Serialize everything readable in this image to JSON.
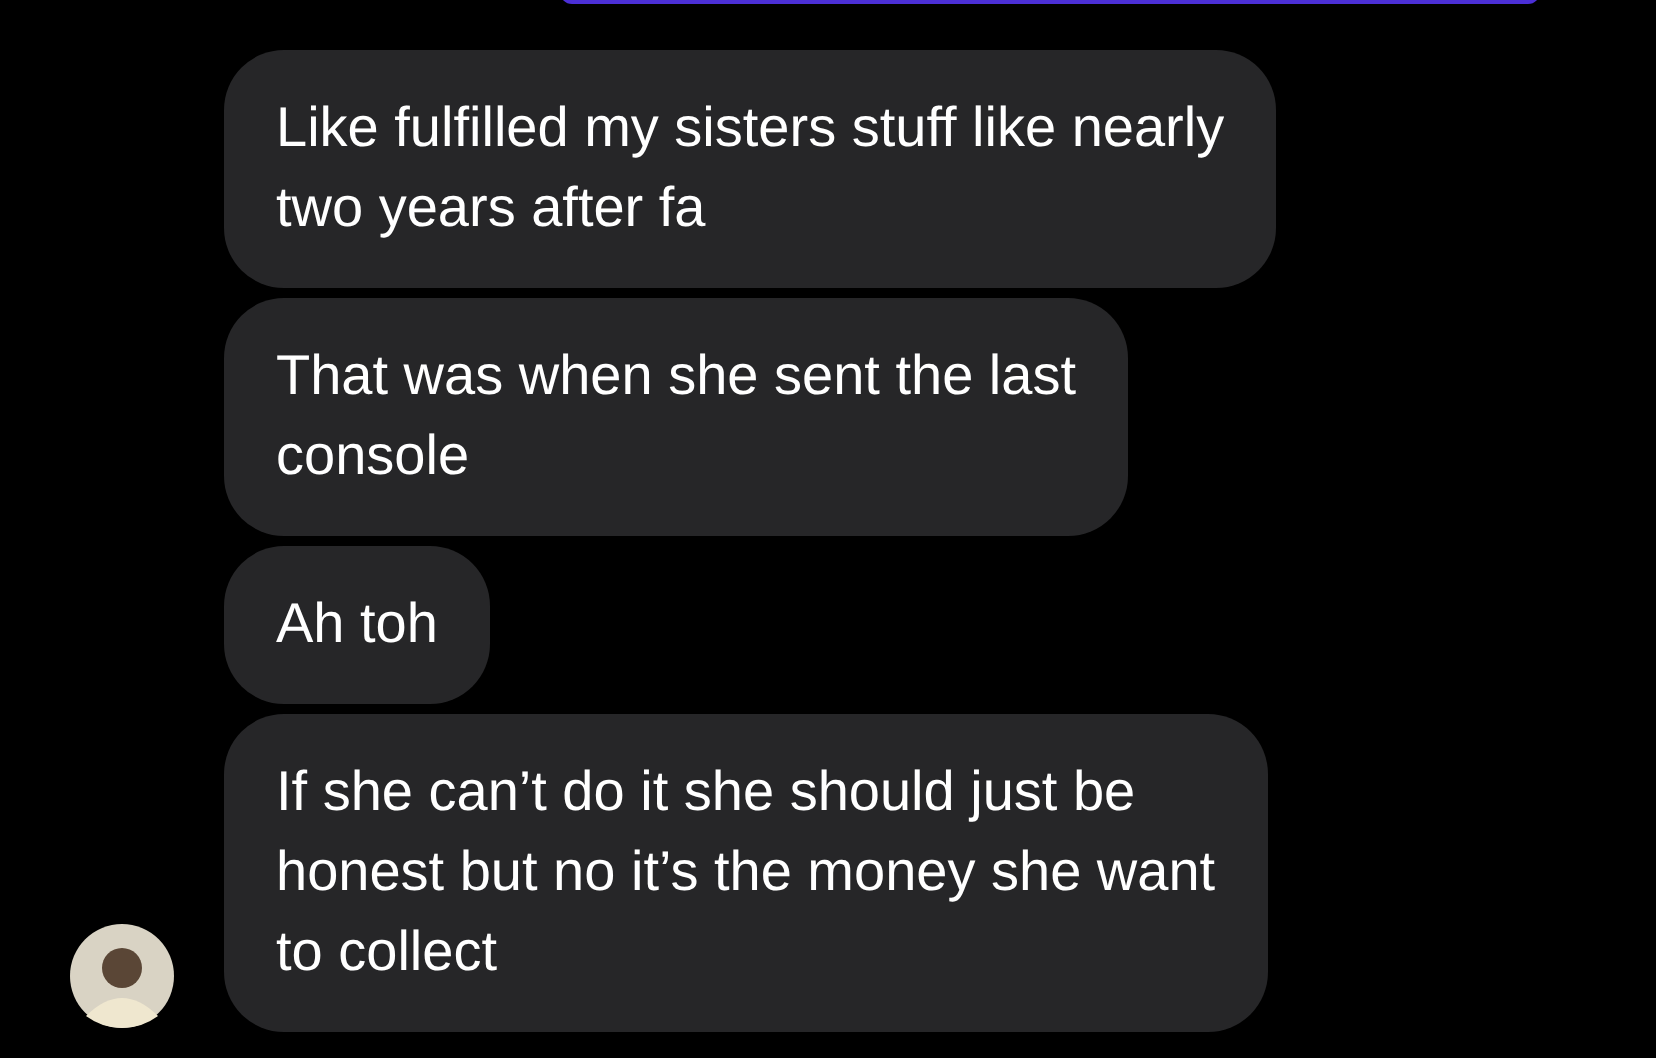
{
  "messages": [
    {
      "text": "Like fulfilled my sisters stuff like nearly\ntwo years after fa",
      "show_avatar": false
    },
    {
      "text": "That was when she sent the last\nconsole",
      "show_avatar": false
    },
    {
      "text": "Ah toh",
      "show_avatar": false
    },
    {
      "text": "If she can’t do it she should just be\nhonest but no it’s the money she want\nto collect",
      "show_avatar": true
    }
  ]
}
